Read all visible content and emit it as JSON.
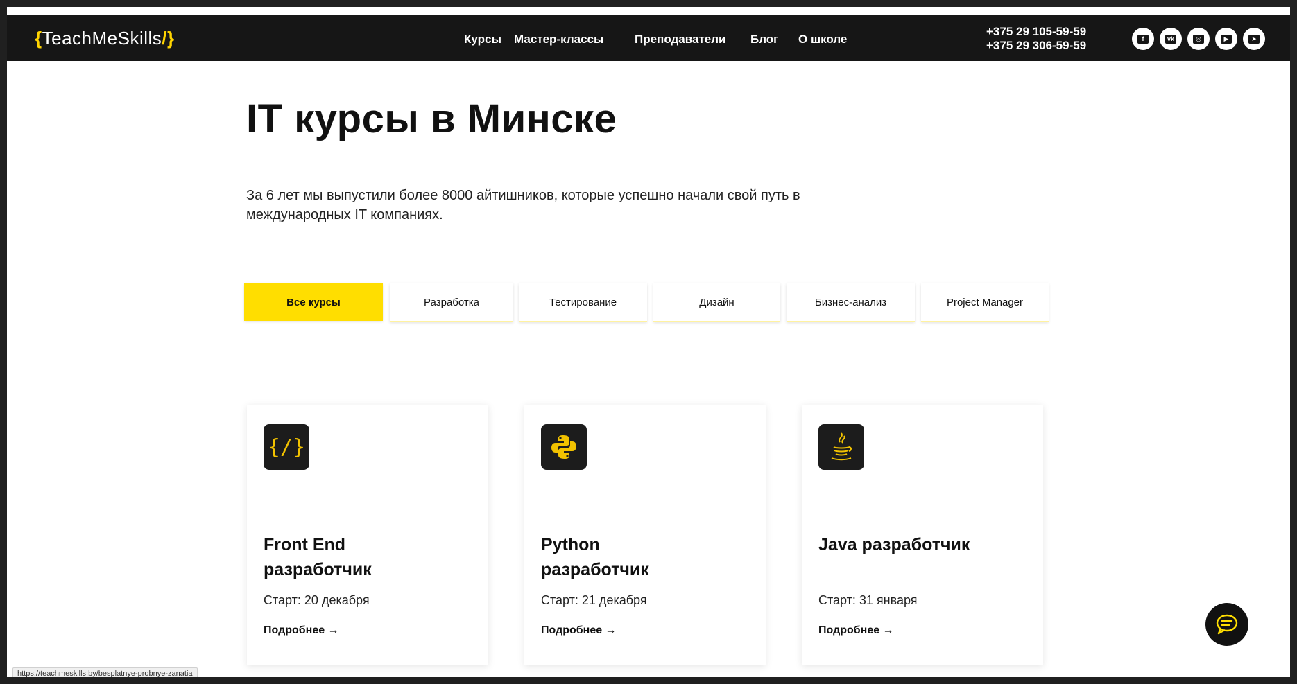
{
  "header": {
    "logo": {
      "open": "{",
      "text": "TeachMeSkills",
      "close": "/}"
    },
    "nav": [
      "Курсы",
      "Мастер-классы",
      "Преподаватели",
      "Блог",
      "О школе"
    ],
    "phones": [
      "+375 29 105-59-59",
      "+375 29 306-59-59"
    ],
    "socials": [
      {
        "name": "facebook-icon",
        "glyph": "f"
      },
      {
        "name": "vk-icon",
        "glyph": "vk"
      },
      {
        "name": "instagram-icon",
        "glyph": "◎"
      },
      {
        "name": "youtube-icon",
        "glyph": "▶"
      },
      {
        "name": "telegram-icon",
        "glyph": "➤"
      }
    ]
  },
  "hero": {
    "title": "IT курсы в Минске",
    "subtitle": "За 6 лет мы выпустили более 8000 айтишников, которые успешно начали свой путь в международных IT компаниях."
  },
  "tabs": [
    {
      "label": "Все курсы",
      "active": true
    },
    {
      "label": "Разработка",
      "active": false
    },
    {
      "label": "Тестирование",
      "active": false
    },
    {
      "label": "Дизайн",
      "active": false
    },
    {
      "label": "Бизнес-анализ",
      "active": false
    },
    {
      "label": "Project Manager",
      "active": false
    }
  ],
  "cards": [
    {
      "icon": "code-brackets-icon",
      "glyph": "{/}",
      "title": "Front End разработчик",
      "start": "Старт: 20 декабря",
      "more": "Подробнее →"
    },
    {
      "icon": "python-icon",
      "glyph": "",
      "title": "Python разработчик",
      "start": "Старт: 21 декабря",
      "more": "Подробнее →"
    },
    {
      "icon": "java-icon",
      "glyph": "",
      "title": "Java разработчик",
      "start": "Старт: 31 января",
      "more": "Подробнее →"
    }
  ],
  "status_url": "https://teachmeskills.by/besplatnye-probnye-zanatia",
  "colors": {
    "accent": "#ffde00",
    "dark": "#161616"
  }
}
